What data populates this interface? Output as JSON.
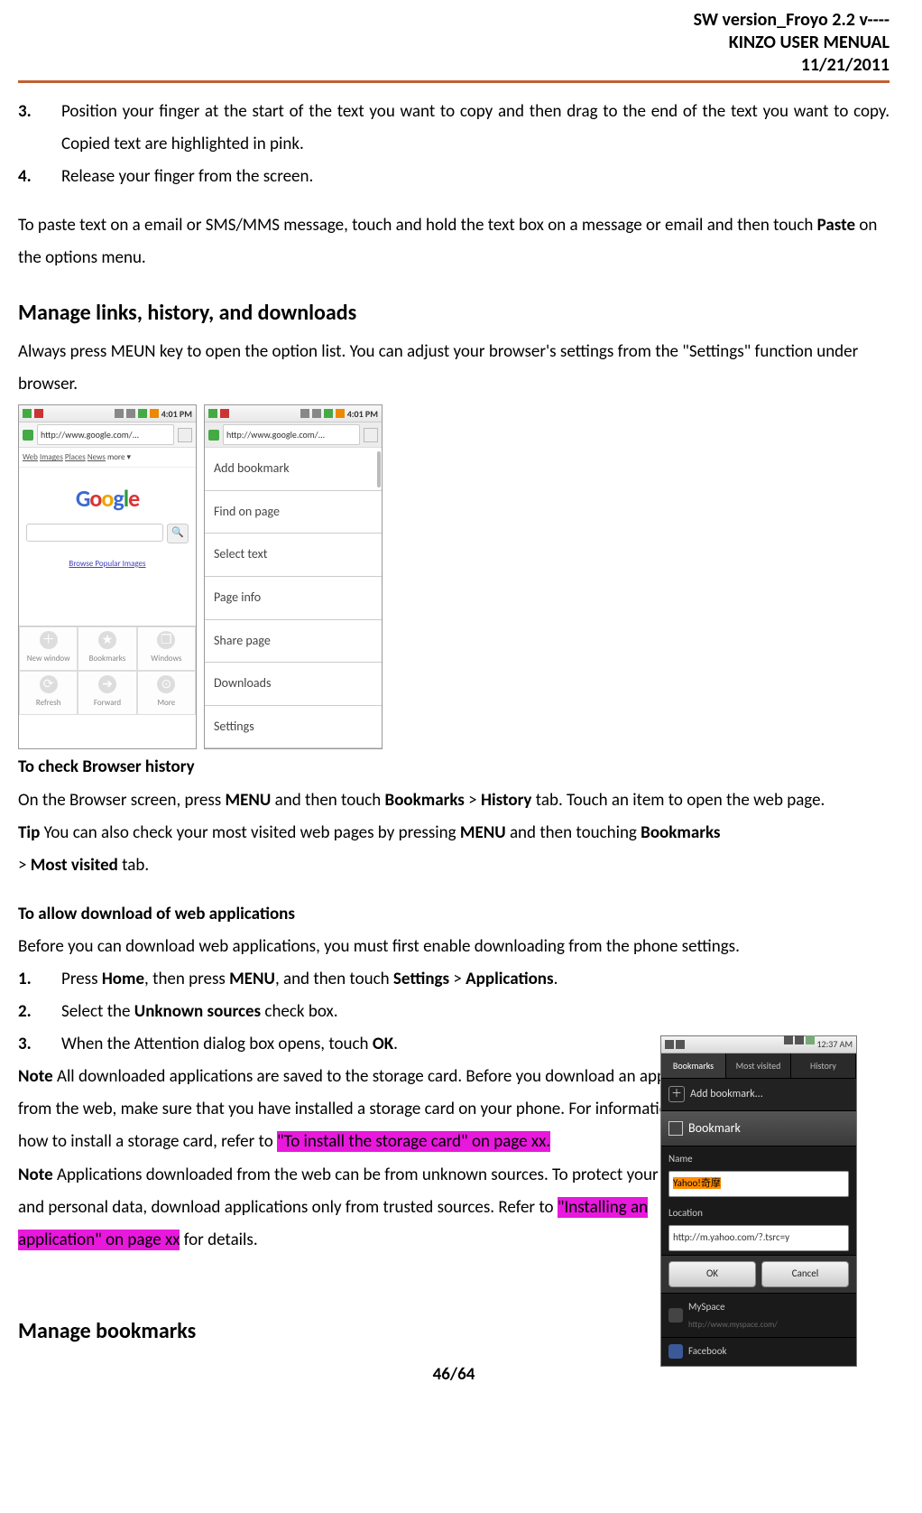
{
  "header": {
    "line1": "SW version_Froyo 2.2 v----",
    "line2": "KINZO USER MENUAL",
    "line3": "11/21/2011"
  },
  "body": {
    "item3_num": "3.",
    "item3_text": "Position your finger at the start of the text you want to copy and then drag to the end of the text you want to copy.  Copied text are highlighted in pink.",
    "item4_num": "4.",
    "item4_text": "Release your finger from the screen.",
    "paste_pre": "To paste text on a email or SMS/MMS message, touch and hold the text box on a message or email and then touch ",
    "paste_bold": "Paste",
    "paste_post": " on the options menu.",
    "h_manage": "Manage links, history, and downloads",
    "manage_p": "Always press MEUN key to open the option list.  You can adjust your browser's settings from the \"Settings\" function under browser.",
    "h_history": "To check Browser history",
    "hist_pre": "On the Browser screen, press ",
    "hist_b1": "MENU",
    "hist_mid1": " and then touch ",
    "hist_b2": "Bookmarks",
    "hist_gt1": " > ",
    "hist_b3": "History",
    "hist_post": " tab. Touch an item to open the web page.",
    "tip_b": "Tip",
    "tip_mid1": " You can also check your most visited web pages by pressing ",
    "tip_b2": "MENU",
    "tip_mid2": " and then touching ",
    "tip_b3": "Bookmarks",
    "tip_gt": "> ",
    "tip_b4": "Most visited",
    "tip_post": " tab.",
    "h_download": "To allow download of web applications",
    "dl_intro": "Before you can download web applications, you must first enable downloading from the phone settings.",
    "dl1_num": "1.",
    "dl1_pre": "Press ",
    "dl1_b1": "Home",
    "dl1_mid1": ", then press ",
    "dl1_b2": "MENU",
    "dl1_mid2": ", and then touch ",
    "dl1_b3": "Settings",
    "dl1_gt": " > ",
    "dl1_b4": "Applications",
    "dl1_post": ".",
    "dl2_num": "2.",
    "dl2_pre": "Select the ",
    "dl2_b1": "Unknown sources",
    "dl2_post": " check box.",
    "dl3_num": "3.",
    "dl3_pre": "When the Attention dialog box opens, touch ",
    "dl3_b1": "OK",
    "dl3_post": ".",
    "note1_b": "Note",
    "note1_t1": " All downloaded applications are saved to the storage card. Before you download an application from the web, make sure that you have installed a storage card on your phone. For information on how to install a storage card, refer to ",
    "note1_hl": " \"To install the storage card\" on page xx.",
    "note2_b": "Note",
    "note2_t1": " Applications downloaded from the web can be from unknown sources. To protect your phone and personal data, download applications only from trusted sources.   Refer to ",
    "note2_hl": " \"Installing an application\" on page xx",
    "note2_post": " for details.",
    "h_bookmarks": "Manage bookmarks",
    "page_num": "46/64"
  },
  "phone1": {
    "time": "4:01 PM",
    "url": "http://www.google.com/...",
    "nav": {
      "web": "Web",
      "images": "Images",
      "places": "Places",
      "news": "News",
      "more": "more ▾"
    },
    "logo": {
      "g1": "G",
      "o1": "o",
      "o2": "o",
      "g2": "g",
      "l": "l",
      "e": "e"
    },
    "browse": "Browse Popular Images",
    "menu": {
      "newwin": "New window",
      "bookmarks": "Bookmarks",
      "windows": "Windows",
      "refresh": "Refresh",
      "forward": "Forward",
      "more": "More"
    },
    "icons": {
      "plus": "＋",
      "star": "★",
      "win": "❐",
      "refresh": "⟳",
      "fwd": "➔",
      "more": "⊙",
      "search": "🔍"
    }
  },
  "phone2": {
    "time": "4:01 PM",
    "url": "http://www.google.com/...",
    "items": [
      "Add bookmark",
      "Find on page",
      "Select text",
      "Page info",
      "Share page",
      "Downloads",
      "Settings"
    ]
  },
  "bmshot": {
    "time": "12:37 AM",
    "tabs": {
      "bookmarks": "Bookmarks",
      "most": "Most visited",
      "history": "History"
    },
    "addrow": "Add bookmark...",
    "header": "Bookmark",
    "name_lbl": "Name",
    "name_val": "Yahoo!奇摩",
    "loc_lbl": "Location",
    "loc_val": "http://m.yahoo.com/?.tsrc=y",
    "ok": "OK",
    "cancel": "Cancel",
    "item1": {
      "t": "MySpace",
      "s": "http://www.myspace.com/"
    },
    "item2": {
      "t": "Facebook",
      "s": ""
    }
  }
}
